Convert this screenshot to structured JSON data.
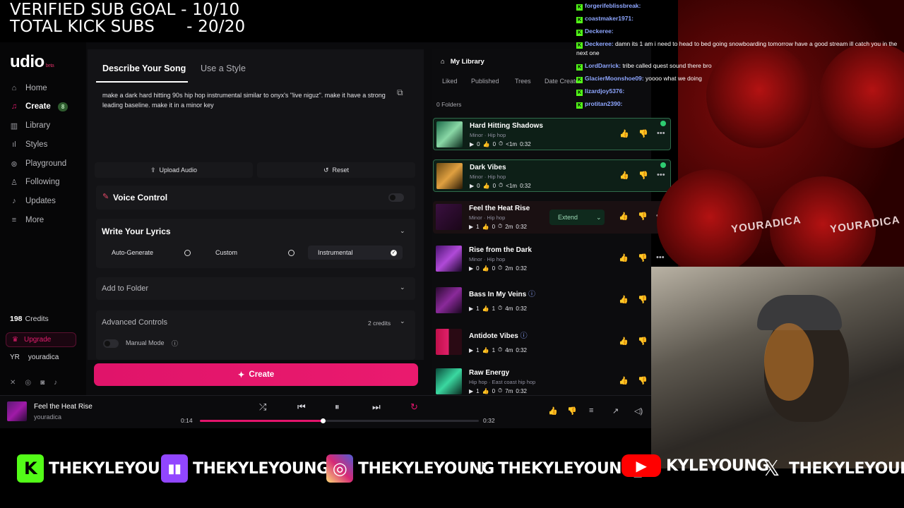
{
  "overlay": {
    "goal_line1": "VERIFIED SUB GOAL - 10/10",
    "goal_line2": "TOTAL KICK SUBS      - 20/20"
  },
  "sidebar": {
    "logo": "udio",
    "logo_badge": "beta",
    "items": [
      {
        "label": "Home",
        "icon": "home-icon"
      },
      {
        "label": "Create",
        "icon": "create-icon",
        "badge": "8"
      },
      {
        "label": "Library",
        "icon": "library-icon"
      },
      {
        "label": "Styles",
        "icon": "styles-icon"
      },
      {
        "label": "Playground",
        "icon": "playground-icon"
      },
      {
        "label": "Following",
        "icon": "user-icon"
      },
      {
        "label": "Updates",
        "icon": "bell-icon"
      },
      {
        "label": "More",
        "icon": "menu-icon"
      }
    ],
    "credits_count": "198",
    "credits_label": "Credits",
    "upgrade": "Upgrade",
    "user_initials": "YR",
    "username": "youradica"
  },
  "create": {
    "tab_describe": "Describe Your Song",
    "tab_style": "Use a Style",
    "prompt": "make a dark hard hitting 90s hip hop instrumental similar to onyx's \"live niguz\". make it have a strong leading baseline. make it in a minor key",
    "upload_audio": "Upload Audio",
    "reset": "Reset",
    "voice_control": "Voice Control",
    "write_lyrics": "Write Your Lyrics",
    "lyric_options": [
      "Auto-Generate",
      "Custom",
      "Instrumental"
    ],
    "add_to_folder": "Add to Folder",
    "advanced_controls": "Advanced Controls",
    "advanced_cost": "2 credits",
    "manual_mode": "Manual Mode",
    "create_button": "Create"
  },
  "library": {
    "title": "My Library",
    "filters": [
      "Liked",
      "Published",
      "Trees",
      "Date Created"
    ],
    "folders": "0 Folders",
    "songs": [
      {
        "title": "Hard Hitting Shadows",
        "meta": "Minor  ·  Hip hop",
        "plays": "0",
        "likes": "0",
        "age": "<1m",
        "duration": "0:32"
      },
      {
        "title": "Dark Vibes",
        "meta": "Minor  ·  Hip hop",
        "plays": "0",
        "likes": "0",
        "age": "<1m",
        "duration": "0:32"
      },
      {
        "title": "Feel the Heat Rise",
        "meta": "Minor  ·  Hip hop",
        "plays": "1",
        "likes": "0",
        "age": "2m",
        "duration": "0:32",
        "extend": "Extend"
      },
      {
        "title": "Rise from the Dark",
        "meta": "Minor  ·  Hip hop",
        "plays": "0",
        "likes": "0",
        "age": "2m",
        "duration": "0:32"
      },
      {
        "title": "Bass In My Veins",
        "meta": "",
        "plays": "1",
        "likes": "1",
        "age": "4m",
        "duration": "0:32"
      },
      {
        "title": "Antidote Vibes",
        "meta": "",
        "plays": "1",
        "likes": "1",
        "age": "4m",
        "duration": "0:32"
      },
      {
        "title": "Raw Energy",
        "meta": "Hip hop  ·  East coast hip hop",
        "plays": "1",
        "likes": "0",
        "age": "7m",
        "duration": "0:32"
      }
    ]
  },
  "player": {
    "title": "Feel the Heat Rise",
    "artist": "youradica",
    "elapsed": "0:14",
    "total": "0:32",
    "progress": 0.44
  },
  "chat": [
    {
      "user": "forgerifeblissbreak:",
      "msg": ""
    },
    {
      "user": "coastmaker1971:",
      "msg": ""
    },
    {
      "user": "Deckeree:",
      "msg": ""
    },
    {
      "user": "Deckeree:",
      "msg": "damn its 1 am i need to head to bed going snowboarding tomorrow have a good stream ill catch you in the next one"
    },
    {
      "user": "LordDarrick:",
      "msg": "tribe called quest sound there bro"
    },
    {
      "user": "GlacierMoonshoe09:",
      "msg": "yoooo what we doing"
    },
    {
      "user": "lizardjoy5376:",
      "msg": ""
    },
    {
      "user": "protitan2390:",
      "msg": ""
    }
  ],
  "emote_text": "YOURADICA",
  "socials": [
    {
      "label": "THEKYLEYOUNG",
      "icon": "kick-icon",
      "color": "#53fc18"
    },
    {
      "label": "THEKYLEYOUNGTV",
      "icon": "twitch-icon",
      "color": "#9146ff"
    },
    {
      "label": "THEKYLEYOUNG",
      "icon": "instagram-icon",
      "color": "#d62976"
    },
    {
      "label": "THEKYLEYOUNG_",
      "icon": "tiktok-icon",
      "color": "#000000"
    },
    {
      "label": "KYLEYOUNG",
      "icon": "youtube-icon",
      "color": "#ff0000"
    },
    {
      "label": "THEKYLEYOUNG",
      "icon": "x-icon",
      "color": "#000000"
    }
  ]
}
